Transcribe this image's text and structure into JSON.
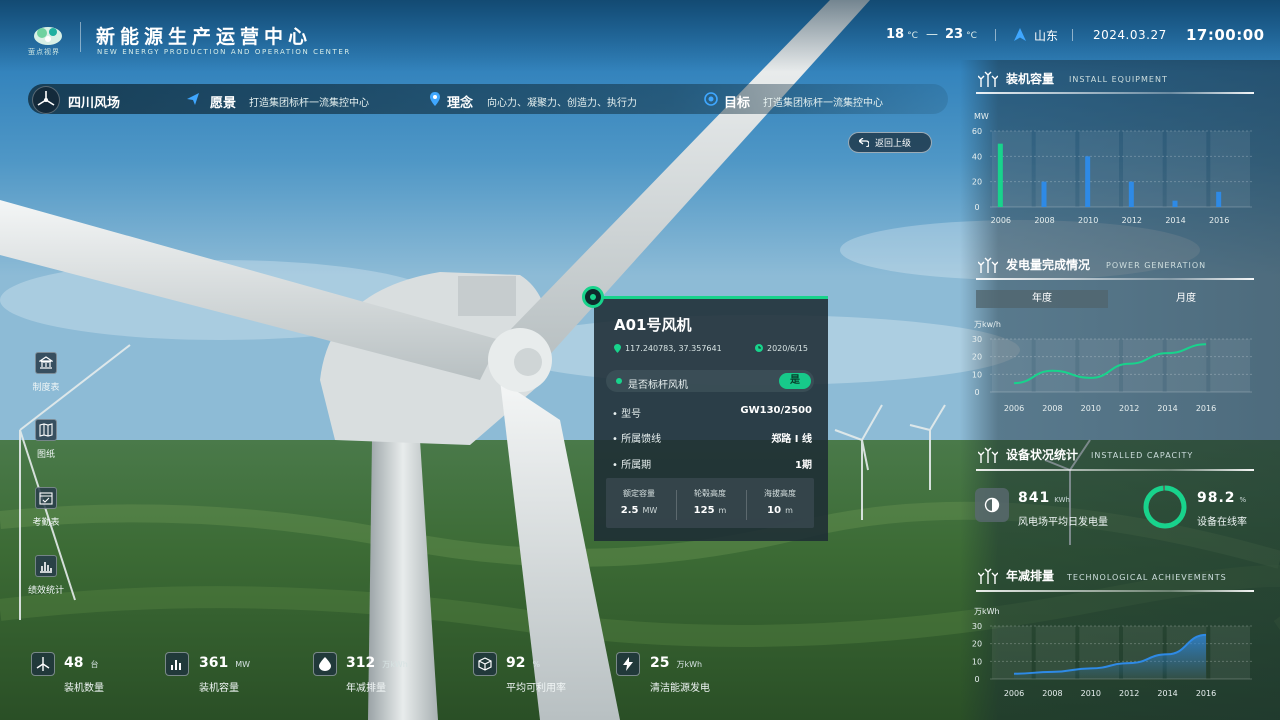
{
  "header": {
    "logo_text": "萤点视界",
    "title": "新能源生产运营中心",
    "subtitle": "NEW ENERGY PRODUCTION AND OPERATION CENTER",
    "temp_low": "18",
    "temp_high": "23",
    "temp_unit": "°C",
    "temp_dash": "—",
    "location": "山东",
    "date": "2024.03.27",
    "time": "17:00:00"
  },
  "infobar": {
    "farm_name": "四川风场",
    "vision_label": "愿景",
    "vision_value": "打造集团标杆一流集控中心",
    "concept_label": "理念",
    "concept_value": "向心力、凝聚力、创造力、执行力",
    "goal_label": "目标",
    "goal_value": "打造集团标杆一流集控中心"
  },
  "back_button": {
    "label": "返回上级"
  },
  "sidebar": {
    "items": [
      {
        "label": "制度表"
      },
      {
        "label": "图纸"
      },
      {
        "label": "考勤表"
      },
      {
        "label": "绩效统计"
      }
    ]
  },
  "turbine_card": {
    "title": "A01号风机",
    "coords": "117.240783, 37.357641",
    "date": "2020/6/15",
    "benchmark_label": "是否标杆风机",
    "benchmark_value": "是",
    "rows": [
      {
        "label": "• 型号",
        "value": "GW130/2500"
      },
      {
        "label": "• 所属馈线",
        "value": "郑路 I 线"
      },
      {
        "label": "• 所属期",
        "value": "1期"
      }
    ],
    "stats": [
      {
        "label": "额定容量",
        "value": "2.5",
        "unit": "MW"
      },
      {
        "label": "轮毂高度",
        "value": "125",
        "unit": "m"
      },
      {
        "label": "海拔高度",
        "value": "10",
        "unit": "m"
      }
    ]
  },
  "bottom_stats": [
    {
      "value": "48",
      "unit": "台",
      "label": "装机数量"
    },
    {
      "value": "361",
      "unit": "MW",
      "label": "装机容量"
    },
    {
      "value": "312",
      "unit": "万kWh",
      "label": "年减排量"
    },
    {
      "value": "92",
      "unit": "%",
      "label": "平均可利用率"
    },
    {
      "value": "25",
      "unit": "万kWh",
      "label": "清洁能源发电"
    }
  ],
  "right_panel": {
    "install": {
      "title": "装机容量",
      "subtitle": "INSTALL EQUIPMENT"
    },
    "generation": {
      "title": "发电量完成情况",
      "subtitle": "POWER GENERATION",
      "tab_year": "年度",
      "tab_month": "月度"
    },
    "status": {
      "title": "设备状况统计",
      "subtitle": "INSTALLED CAPACITY",
      "kpi1_value": "841",
      "kpi1_unit": "KWh",
      "kpi1_label": "风电场平均日发电量",
      "kpi2_value": "98.2",
      "kpi2_unit": "%",
      "kpi2_label": "设备在线率",
      "online_rate": 0.982
    },
    "reduction": {
      "title": "年减排量",
      "subtitle": "TECHNOLOGICAL ACHIEVEMENTS"
    }
  },
  "colors": {
    "accent": "#18d38c",
    "line_blue": "#2e8ae6",
    "bar_blue": "#2e8ae6",
    "bar_green": "#18d38c"
  },
  "chart_data": [
    {
      "type": "bar",
      "ylabel": "MW",
      "categories": [
        "2006",
        "2008",
        "2010",
        "2012",
        "2014",
        "2016"
      ],
      "values": [
        50,
        20,
        40,
        20,
        5,
        12
      ],
      "ylim": [
        0,
        60
      ],
      "yticks": [
        0,
        20,
        40,
        60
      ],
      "grid": true
    },
    {
      "type": "line",
      "ylabel": "万kw/h",
      "x": [
        "2006",
        "2008",
        "2010",
        "2012",
        "2014",
        "2016"
      ],
      "values": [
        5,
        12,
        8,
        16,
        22,
        27
      ],
      "ylim": [
        0,
        30
      ],
      "yticks": [
        0,
        10,
        20,
        30
      ],
      "grid": true
    },
    {
      "type": "area",
      "ylabel": "万kWh",
      "x": [
        "2006",
        "2008",
        "2010",
        "2012",
        "2014",
        "2016"
      ],
      "values": [
        3,
        4,
        6,
        9,
        14,
        25
      ],
      "ylim": [
        0,
        30
      ],
      "yticks": [
        0,
        10,
        20,
        30
      ],
      "grid": true
    }
  ]
}
